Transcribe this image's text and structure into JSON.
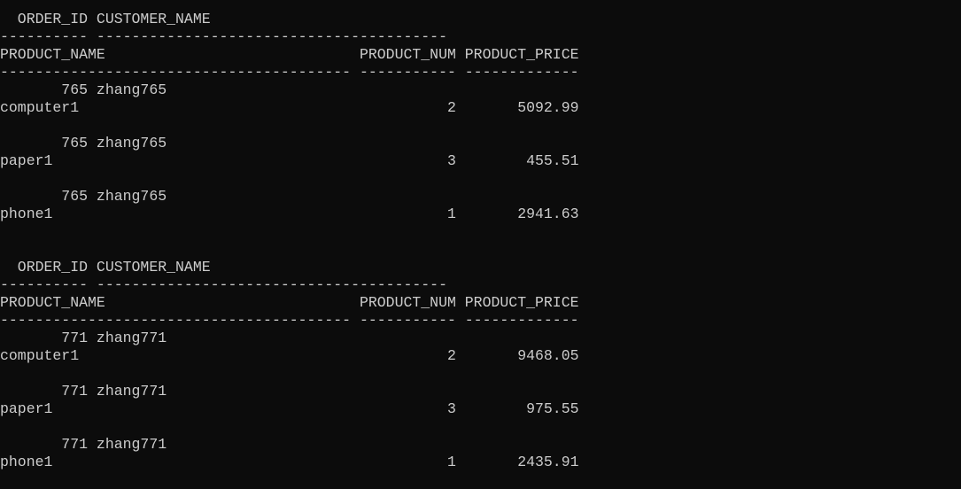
{
  "colors": {
    "background": "#0c0c0c",
    "text": "#cccccc"
  },
  "console": {
    "lines": [
      "  ORDER_ID CUSTOMER_NAME",
      "---------- ----------------------------------------",
      "PRODUCT_NAME                             PRODUCT_NUM PRODUCT_PRICE",
      "---------------------------------------- ----------- -------------",
      "       765 zhang765",
      "computer1                                          2       5092.99",
      "",
      "       765 zhang765",
      "paper1                                             3        455.51",
      "",
      "       765 zhang765",
      "phone1                                             1       2941.63",
      "",
      "",
      "  ORDER_ID CUSTOMER_NAME",
      "---------- ----------------------------------------",
      "PRODUCT_NAME                             PRODUCT_NUM PRODUCT_PRICE",
      "---------------------------------------- ----------- -------------",
      "       771 zhang771",
      "computer1                                          2       9468.05",
      "",
      "       771 zhang771",
      "paper1                                             3        975.55",
      "",
      "       771 zhang771",
      "phone1                                             1       2435.91"
    ]
  }
}
